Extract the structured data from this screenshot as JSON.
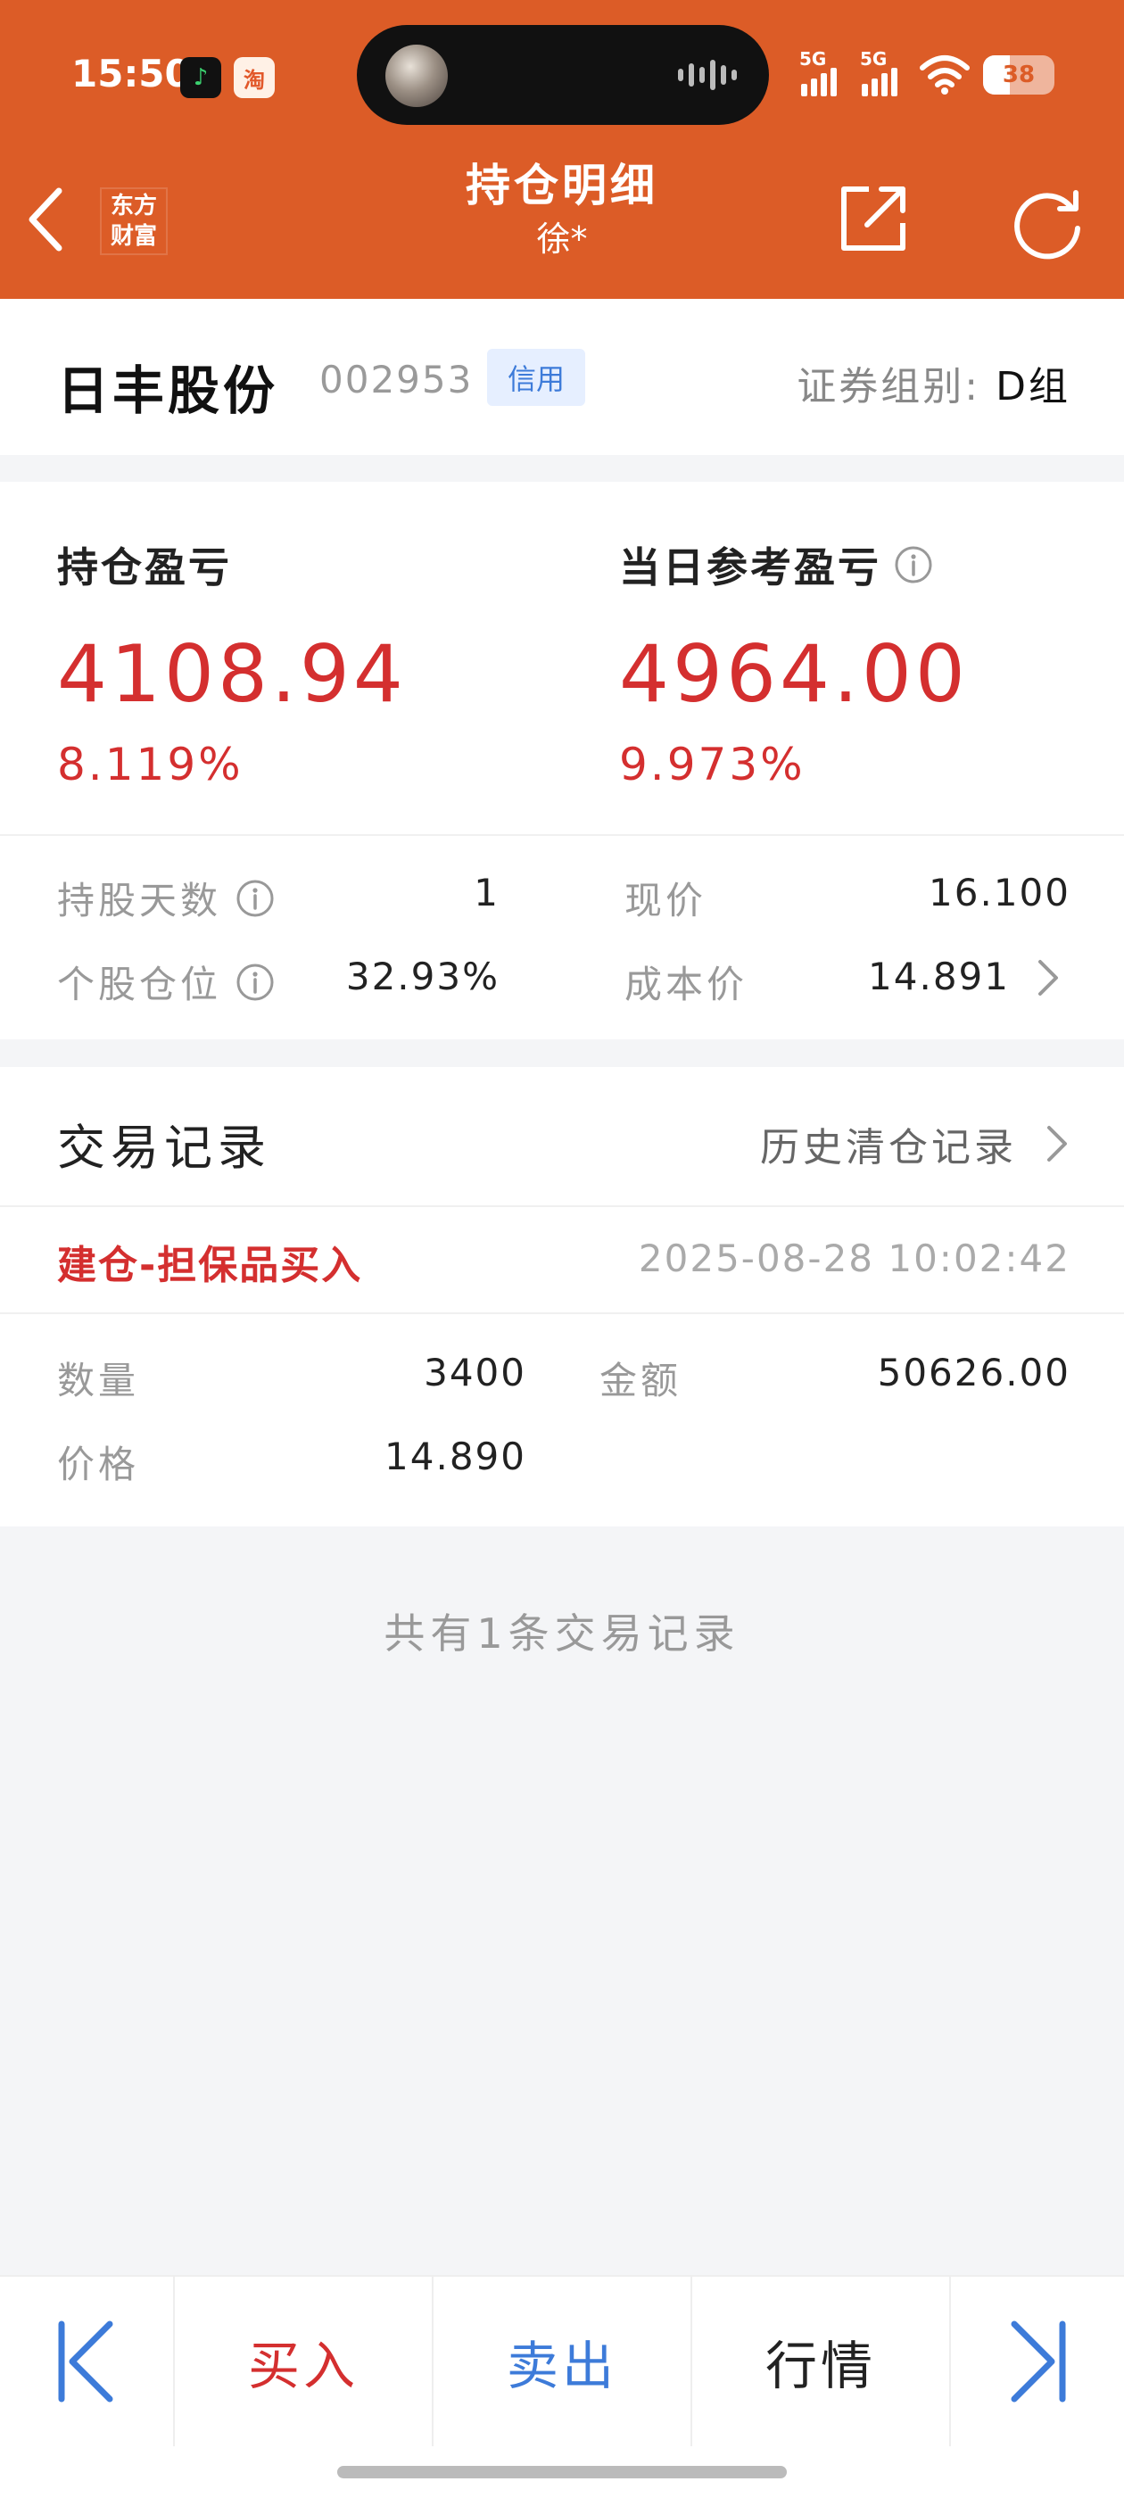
{
  "status_bar": {
    "time": "15:50",
    "app_icons": [
      "music-app-icon",
      "taobao-icon"
    ],
    "taobao_label": "淘",
    "signal_1": "5G",
    "signal_2": "5G",
    "battery": "38",
    "battery_level": 0.38
  },
  "header": {
    "logo_line1": "东方",
    "logo_line2": "财富",
    "title": "持仓明细",
    "subtitle": "徐*",
    "icons": [
      "back-icon",
      "share-icon",
      "refresh-icon"
    ]
  },
  "stock": {
    "name": "日丰股份",
    "code": "002953",
    "badge": "信用",
    "group_label": "证券组别:",
    "group_value": "D组"
  },
  "pnl": {
    "holding_label": "持仓盈亏",
    "holding_value": "4108.94",
    "holding_pct": "8.119%",
    "daily_label": "当日参考盈亏",
    "daily_value": "4964.00",
    "daily_pct": "9.973%"
  },
  "details": {
    "days_label": "持股天数",
    "days_value": "1",
    "price_label": "现价",
    "price_value": "16.100",
    "position_label": "个股仓位",
    "position_value": "32.93%",
    "cost_label": "成本价",
    "cost_value": "14.891"
  },
  "trades": {
    "section_title": "交易记录",
    "history_link": "历史清仓记录",
    "records": [
      {
        "type": "建仓-担保品买入",
        "time": "2025-08-28 10:02:42",
        "qty_label": "数量",
        "qty": "3400",
        "amount_label": "金额",
        "amount": "50626.00",
        "price_label": "价格",
        "price": "14.890"
      }
    ],
    "count_text": "共有1条交易记录"
  },
  "bottom_bar": {
    "buy": "买入",
    "sell": "卖出",
    "quote": "行情"
  },
  "colors": {
    "brand": "#dc5c27",
    "up_red": "#d42f2f",
    "link_blue": "#3d7bd9"
  }
}
